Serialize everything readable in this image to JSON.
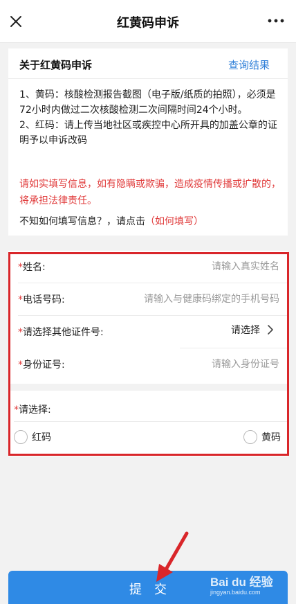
{
  "header": {
    "title": "红黄码申诉",
    "close_icon": "close-icon",
    "more_icon": "more-icon"
  },
  "info": {
    "title": "关于红黄码申诉",
    "link": "查询结果",
    "rule1": "1、黄码：核酸检测报告截图（电子版/纸质的拍照），必须是72小时内做过二次核酸检测二次间隔时间24个小时。",
    "rule2": "2、红码：请上传当地社区或疾控中心所开具的加盖公章的证明予以申诉改码",
    "warning": "请如实填写信息，如有隐瞒或欺骗，造成疫情传播或扩散的，将承担法律责任。",
    "howto_prefix": "不知如何填写信息？，请点击",
    "howto_link": "（如何填写）"
  },
  "form": {
    "required_mark": "*",
    "name_label": "姓名:",
    "name_placeholder": "请输入真实姓名",
    "phone_label": "电话号码:",
    "phone_placeholder": "请输入与健康码绑定的手机号码",
    "idtype_label": "请选择其他证件号:",
    "idtype_value": "请选择",
    "id_label": "身份证号:",
    "id_placeholder": "请输入身份证号",
    "choose_label": "请选择:",
    "option_red": "红码",
    "option_yellow": "黄码"
  },
  "submit_label": "提交",
  "watermark": {
    "main": "Bai du 经验",
    "sub": "jingyan.baidu.com"
  },
  "colors": {
    "accent": "#2f8ae5",
    "link": "#2f7fd8",
    "warning": "#e03a3a",
    "highlight": "#d9262a"
  }
}
